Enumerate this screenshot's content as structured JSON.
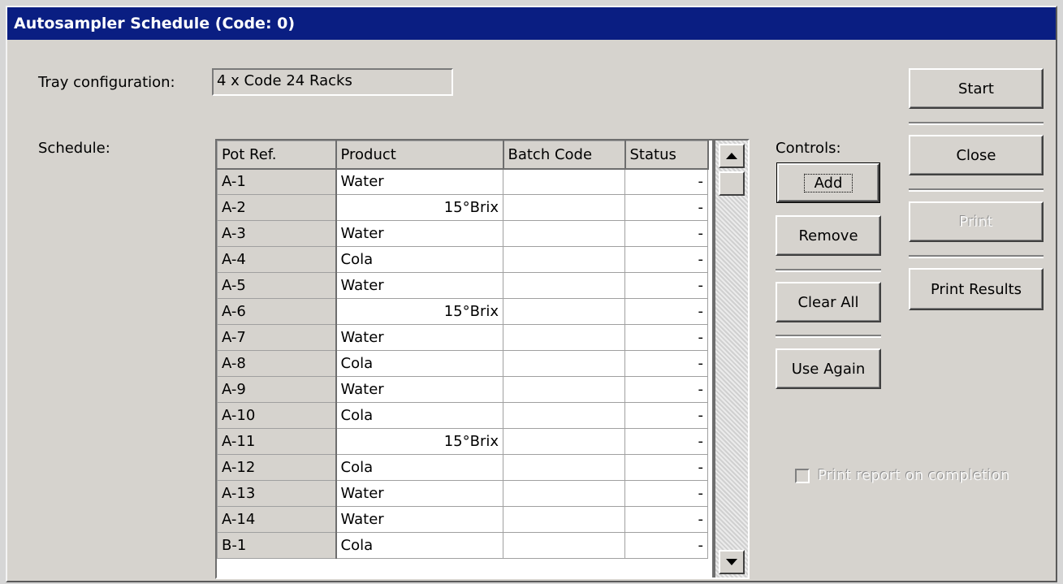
{
  "window": {
    "title": "Autosampler Schedule (Code: 0)"
  },
  "tray": {
    "label": "Tray configuration:",
    "value": "4 x Code 24 Racks"
  },
  "schedule": {
    "label": "Schedule:",
    "columns": [
      "Pot Ref.",
      "Product",
      "Batch Code",
      "Status"
    ],
    "rows": [
      {
        "ref": "A-1",
        "product": "Water",
        "align": "left",
        "batch": "",
        "status": "-"
      },
      {
        "ref": "A-2",
        "product": "15°Brix",
        "align": "right",
        "batch": "",
        "status": "-"
      },
      {
        "ref": "A-3",
        "product": "Water",
        "align": "left",
        "batch": "",
        "status": "-"
      },
      {
        "ref": "A-4",
        "product": "Cola",
        "align": "left",
        "batch": "",
        "status": "-"
      },
      {
        "ref": "A-5",
        "product": "Water",
        "align": "left",
        "batch": "",
        "status": "-"
      },
      {
        "ref": "A-6",
        "product": "15°Brix",
        "align": "right",
        "batch": "",
        "status": "-"
      },
      {
        "ref": "A-7",
        "product": "Water",
        "align": "left",
        "batch": "",
        "status": "-"
      },
      {
        "ref": "A-8",
        "product": "Cola",
        "align": "left",
        "batch": "",
        "status": "-"
      },
      {
        "ref": "A-9",
        "product": "Water",
        "align": "left",
        "batch": "",
        "status": "-"
      },
      {
        "ref": "A-10",
        "product": "Cola",
        "align": "left",
        "batch": "",
        "status": "-"
      },
      {
        "ref": "A-11",
        "product": "15°Brix",
        "align": "right",
        "batch": "",
        "status": "-"
      },
      {
        "ref": "A-12",
        "product": "Cola",
        "align": "left",
        "batch": "",
        "status": "-"
      },
      {
        "ref": "A-13",
        "product": "Water",
        "align": "left",
        "batch": "",
        "status": "-"
      },
      {
        "ref": "A-14",
        "product": "Water",
        "align": "left",
        "batch": "",
        "status": "-"
      },
      {
        "ref": "B-1",
        "product": "Cola",
        "align": "left",
        "batch": "",
        "status": "-"
      }
    ]
  },
  "controls": {
    "label": "Controls:",
    "add": "Add",
    "remove": "Remove",
    "clear_all": "Clear All",
    "use_again": "Use Again"
  },
  "actions": {
    "start": "Start",
    "close": "Close",
    "print": "Print",
    "print_results": "Print Results"
  },
  "print_report": {
    "label": "Print report on completion",
    "checked": false,
    "enabled": false
  },
  "icons": {
    "scroll_up": "scroll-up-arrow-icon",
    "scroll_down": "scroll-down-arrow-icon"
  },
  "colors": {
    "titlebar": "#0a1e82",
    "face": "#d6d3ce"
  }
}
